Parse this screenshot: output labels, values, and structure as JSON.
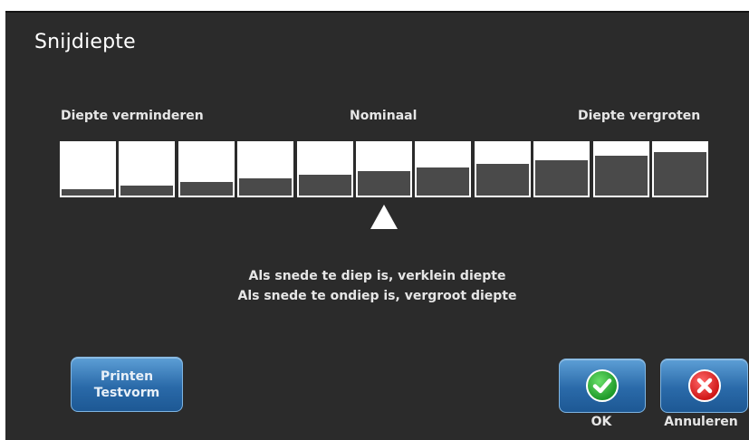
{
  "dialog": {
    "title": "Snijdiepte"
  },
  "scale": {
    "label_decrease": "Diepte verminderen",
    "label_nominal": "Nominaal",
    "label_increase": "Diepte vergroten",
    "levels": [
      0.12,
      0.19,
      0.26,
      0.33,
      0.4,
      0.47,
      0.54,
      0.61,
      0.68,
      0.75,
      0.82
    ],
    "selected_index": 5
  },
  "hints": {
    "line1": "Als snede te diep is, verklein diepte",
    "line2": "Als snede te ondiep is, vergroot diepte"
  },
  "buttons": {
    "test_line1": "Printen",
    "test_line2": "Testvorm",
    "ok_label": "OK",
    "cancel_label": "Annuleren"
  },
  "colors": {
    "background": "#2b2b2b",
    "button_blue": "#2a6aa9",
    "ok_green": "#1f9a2a",
    "cancel_red": "#d01818"
  },
  "icons": {
    "ok": "check-icon",
    "cancel": "x-icon",
    "pointer": "triangle-up-icon"
  }
}
